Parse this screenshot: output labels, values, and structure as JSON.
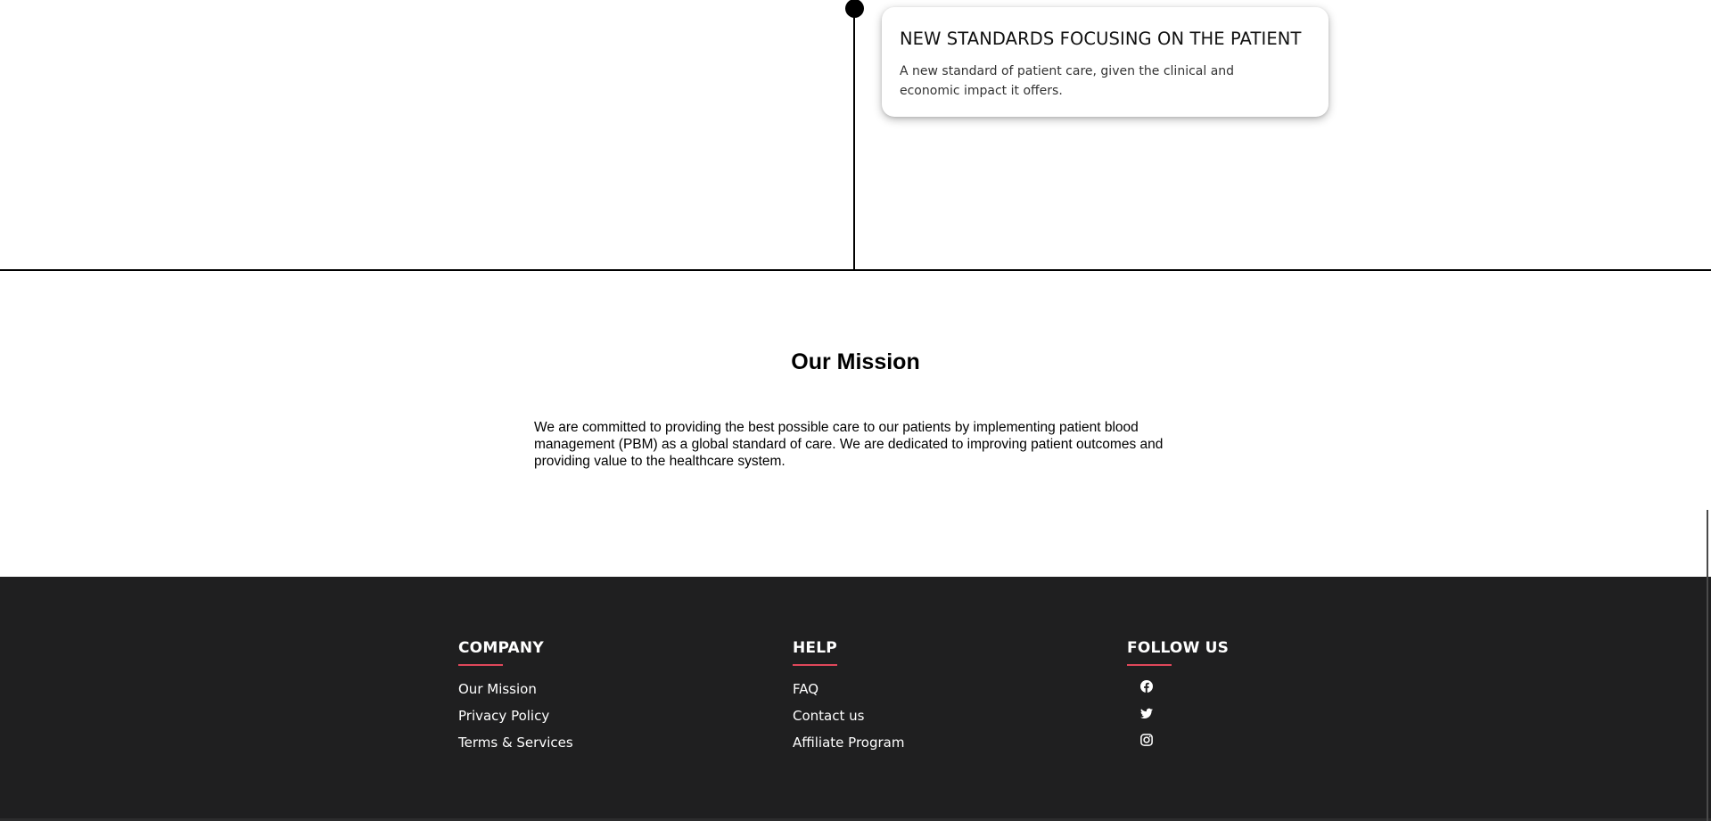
{
  "timeline": {
    "card": {
      "title": "NEW STANDARDS FOCUSING ON THE PATIENT",
      "text": "A new standard of patient care, given the clinical and economic impact it offers."
    }
  },
  "mission": {
    "title": "Our Mission",
    "text": "We are committed to providing the best possible care to our patients by implementing patient blood management (PBM) as a global standard of care. We are dedicated to improving patient outcomes and providing value to the healthcare system."
  },
  "footer": {
    "accent_color": "#e0475b",
    "background_color": "#1f1f20",
    "company": {
      "heading": "COMPANY",
      "links": [
        "Our Mission",
        "Privacy Policy",
        "Terms & Services"
      ]
    },
    "help": {
      "heading": "HELP",
      "links": [
        "FAQ",
        "Contact us",
        "Affiliate Program"
      ]
    },
    "follow": {
      "heading": "FOLLOW US",
      "icons": [
        "facebook-icon",
        "twitter-icon",
        "instagram-icon"
      ]
    }
  }
}
